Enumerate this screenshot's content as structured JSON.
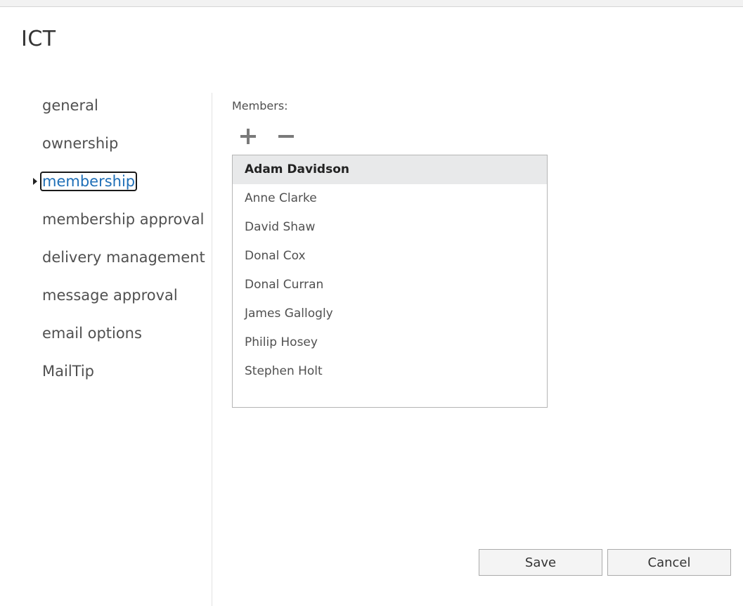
{
  "dialog": {
    "title": "ICT"
  },
  "nav": {
    "items": [
      {
        "label": "general"
      },
      {
        "label": "ownership"
      },
      {
        "label": "membership"
      },
      {
        "label": "membership approval"
      },
      {
        "label": "delivery management"
      },
      {
        "label": "message approval"
      },
      {
        "label": "email options"
      },
      {
        "label": "MailTip"
      }
    ],
    "selected": "membership"
  },
  "membership": {
    "members_label": "Members:",
    "add_icon": "plus-icon",
    "remove_icon": "minus-icon",
    "members": [
      {
        "name": "Adam Davidson"
      },
      {
        "name": "Anne Clarke"
      },
      {
        "name": "David Shaw"
      },
      {
        "name": "Donal Cox"
      },
      {
        "name": "Donal Curran"
      },
      {
        "name": "James Gallogly"
      },
      {
        "name": "Philip Hosey"
      },
      {
        "name": "Stephen Holt"
      }
    ],
    "selected_member": "Adam Davidson"
  },
  "footer": {
    "save_label": "Save",
    "cancel_label": "Cancel"
  },
  "colors": {
    "selected_nav_text": "#1f6fb7",
    "selected_row_bg": "#e8e9ea",
    "icon_gray": "#7a7a7a"
  }
}
